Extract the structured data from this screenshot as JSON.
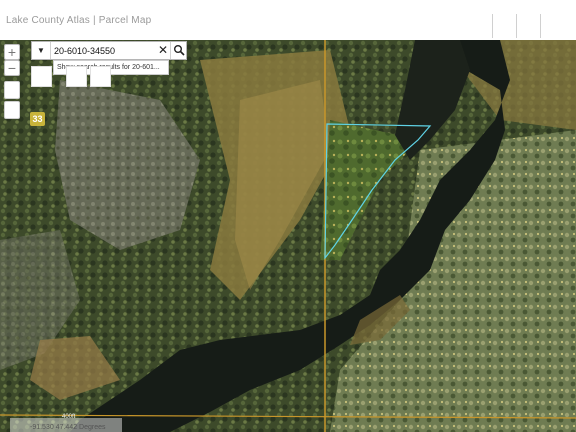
{
  "header": {
    "title": "Lake County Atlas | Parcel Map"
  },
  "map_controls": {
    "zoom_in": "+",
    "zoom_out": "−"
  },
  "search": {
    "value": "20-6010-34550",
    "clear_symbol": "✕",
    "dropdown_symbol": "▼",
    "suggestion": "Show search results for 20-601..."
  },
  "map_labels": {
    "highway_shield": "33",
    "scale_label": "400ft",
    "coordinates": "-91.530 47.442 Degrees"
  },
  "colors": {
    "parcel_outline": "#5fd3e6",
    "road_line": "#c8962a",
    "shield": "#c8b43a"
  },
  "icons": {
    "search": "search-icon",
    "clear": "close-icon",
    "dropdown": "chevron-down-icon"
  }
}
